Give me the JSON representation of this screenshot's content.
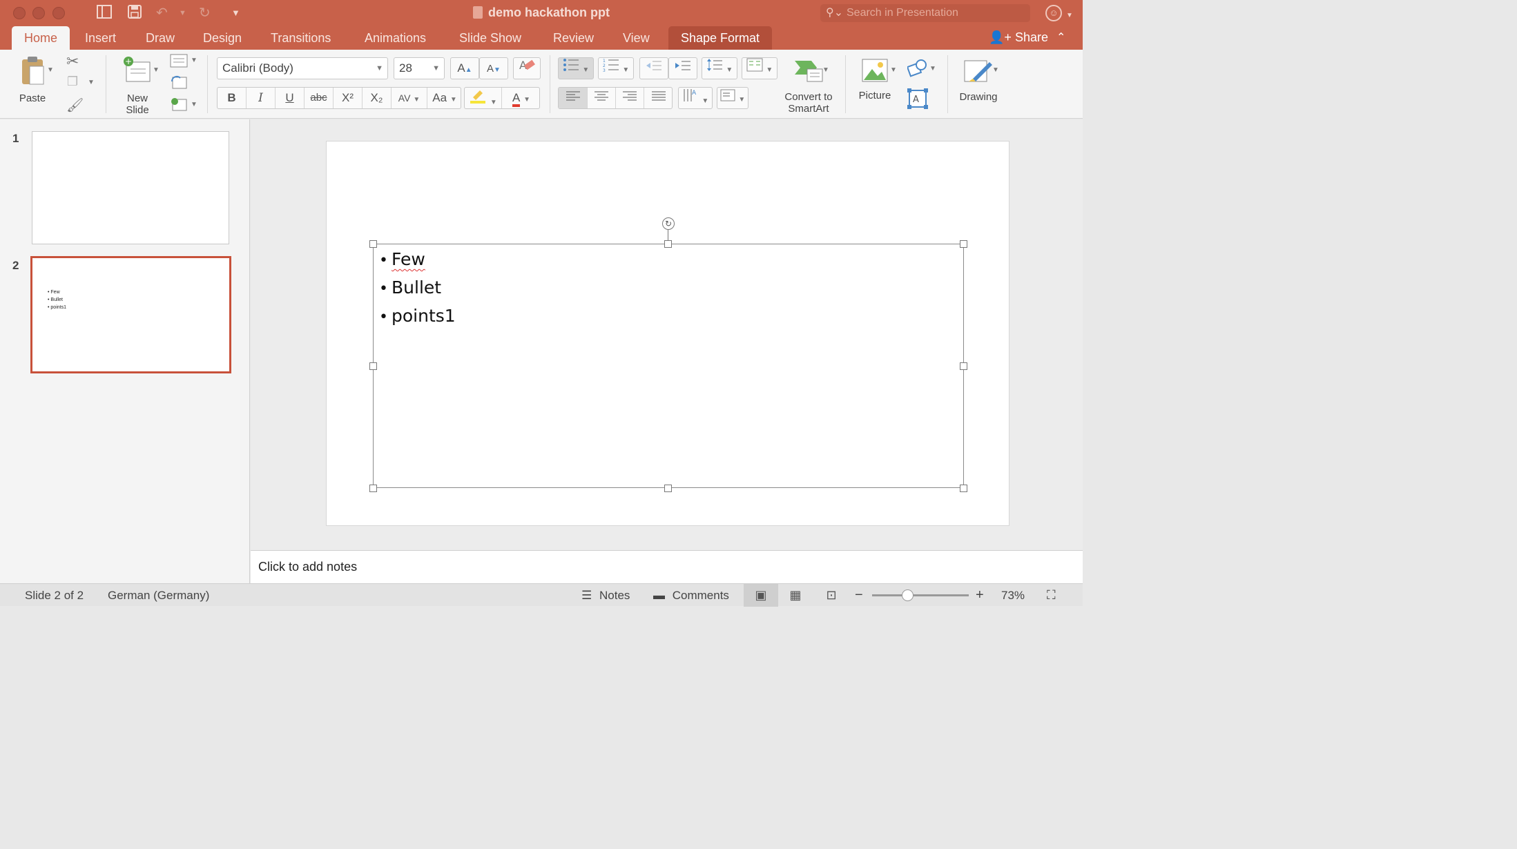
{
  "window": {
    "title": "demo hackathon ppt",
    "search_placeholder": "Search in Presentation"
  },
  "tabs": [
    {
      "label": "Home",
      "active": true
    },
    {
      "label": "Insert"
    },
    {
      "label": "Draw"
    },
    {
      "label": "Design"
    },
    {
      "label": "Transitions"
    },
    {
      "label": "Animations"
    },
    {
      "label": "Slide Show"
    },
    {
      "label": "Review"
    },
    {
      "label": "View"
    },
    {
      "label": "Shape Format"
    }
  ],
  "share_label": "Share",
  "ribbon": {
    "paste_label": "Paste",
    "new_slide_label_1": "New",
    "new_slide_label_2": "Slide",
    "font_name": "Calibri (Body)",
    "font_size": "28",
    "bold": "B",
    "italic": "I",
    "underline": "U",
    "strikethrough": "abc",
    "superscript": "X²",
    "subscript": "X₂",
    "char_spacing": "AV",
    "change_case": "Aa",
    "font_color_glyph": "A",
    "grow_font": "A",
    "shrink_font": "A",
    "smartart_label_1": "Convert to",
    "smartart_label_2": "SmartArt",
    "picture_label": "Picture",
    "drawing_label": "Drawing"
  },
  "slides": [
    {
      "number": "1",
      "bullets": []
    },
    {
      "number": "2",
      "bullets": [
        "Few",
        "Bullet",
        "points1"
      ],
      "selected": true
    }
  ],
  "slide_content": {
    "bullets": [
      "Few",
      "Bullet",
      "points1"
    ]
  },
  "notes_placeholder": "Click to add notes",
  "status": {
    "slide_position": "Slide 2 of 2",
    "language": "German (Germany)",
    "notes_label": "Notes",
    "comments_label": "Comments",
    "zoom_level": "73%"
  },
  "colors": {
    "accent": "#c8614a",
    "selection_border": "#c8513a"
  }
}
